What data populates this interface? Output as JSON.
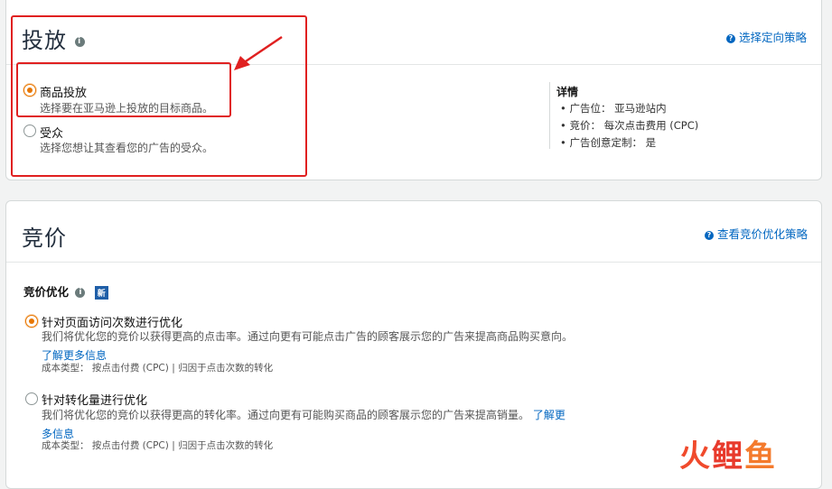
{
  "targeting": {
    "title": "投放",
    "info_icon": "info-icon",
    "link": "选择定向策略",
    "options": [
      {
        "label": "商品投放",
        "desc": "选择要在亚马逊上投放的目标商品。",
        "selected": true
      },
      {
        "label": "受众",
        "desc": "选择您想让其查看您的广告的受众。",
        "selected": false
      }
    ],
    "details": {
      "title": "详情",
      "items": [
        "广告位：  亚马逊站内",
        "竞价：  每次点击费用 (CPC)",
        "广告创意定制：  是"
      ]
    }
  },
  "bidding": {
    "title": "竞价",
    "link": "查看竞价优化策略",
    "section_label": "竞价优化",
    "new_badge": "新",
    "options": [
      {
        "label": "针对页面访问次数进行优化",
        "desc": "我们将优化您的竞价以获得更高的点击率。通过向更有可能点击广告的顾客展示您的广告来提高商品购买意向。",
        "learn_more": "了解更多信息",
        "cost": "成本类型：  按点击付费 (CPC) | 归因于点击次数的转化",
        "selected": true
      },
      {
        "label": "针对转化量进行优化",
        "desc": "我们将优化您的竞价以获得更高的转化率。通过向更有可能购买商品的顾客展示您的广告来提高销量。",
        "learn_more": "了解更多信息",
        "cost": "成本类型：  按点击付费 (CPC) | 归因于点击次数的转化",
        "selected": false
      }
    ]
  },
  "colors": {
    "accent": "#e77600",
    "link": "#0066c0",
    "annotation": "#e02020"
  },
  "watermark": [
    "火",
    "鲤",
    "鱼"
  ]
}
